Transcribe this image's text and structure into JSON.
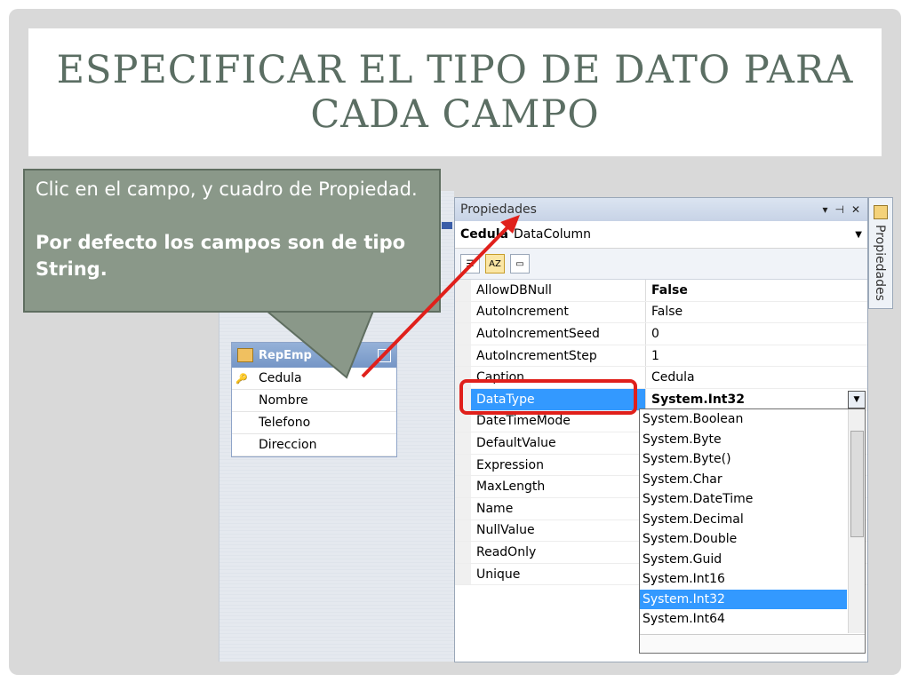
{
  "slide": {
    "title": "ESPECIFICAR EL TIPO DE DATO PARA CADA CAMPO"
  },
  "callout": {
    "line1": "Clic en el campo, y cuadro de Propiedad.",
    "line2": "Por defecto los campos son de tipo String."
  },
  "table": {
    "name": "RepEmp",
    "fields": [
      "Cedula",
      "Nombre",
      "Telefono",
      "Direccion"
    ]
  },
  "properties_panel": {
    "title": "Propiedades",
    "object_name": "Cedula",
    "object_type": "DataColumn",
    "rows": [
      {
        "name": "AllowDBNull",
        "value": "False"
      },
      {
        "name": "AutoIncrement",
        "value": "False"
      },
      {
        "name": "AutoIncrementSeed",
        "value": "0"
      },
      {
        "name": "AutoIncrementStep",
        "value": "1"
      },
      {
        "name": "Caption",
        "value": "Cedula"
      },
      {
        "name": "DataType",
        "value": "System.Int32"
      },
      {
        "name": "DateTimeMode",
        "value": ""
      },
      {
        "name": "DefaultValue",
        "value": ""
      },
      {
        "name": "Expression",
        "value": ""
      },
      {
        "name": "MaxLength",
        "value": ""
      },
      {
        "name": "Name",
        "value": ""
      },
      {
        "name": "NullValue",
        "value": ""
      },
      {
        "name": "ReadOnly",
        "value": ""
      },
      {
        "name": "Unique",
        "value": ""
      }
    ],
    "datatype_options": [
      "System.Boolean",
      "System.Byte",
      "System.Byte()",
      "System.Char",
      "System.DateTime",
      "System.Decimal",
      "System.Double",
      "System.Guid",
      "System.Int16",
      "System.Int32",
      "System.Int64"
    ],
    "side_tab_label": "Propiedades"
  },
  "colors": {
    "title": "#5b6e63",
    "callout_bg": "#8a9889",
    "selection": "#3399ff",
    "highlight_red": "#e0201b"
  }
}
